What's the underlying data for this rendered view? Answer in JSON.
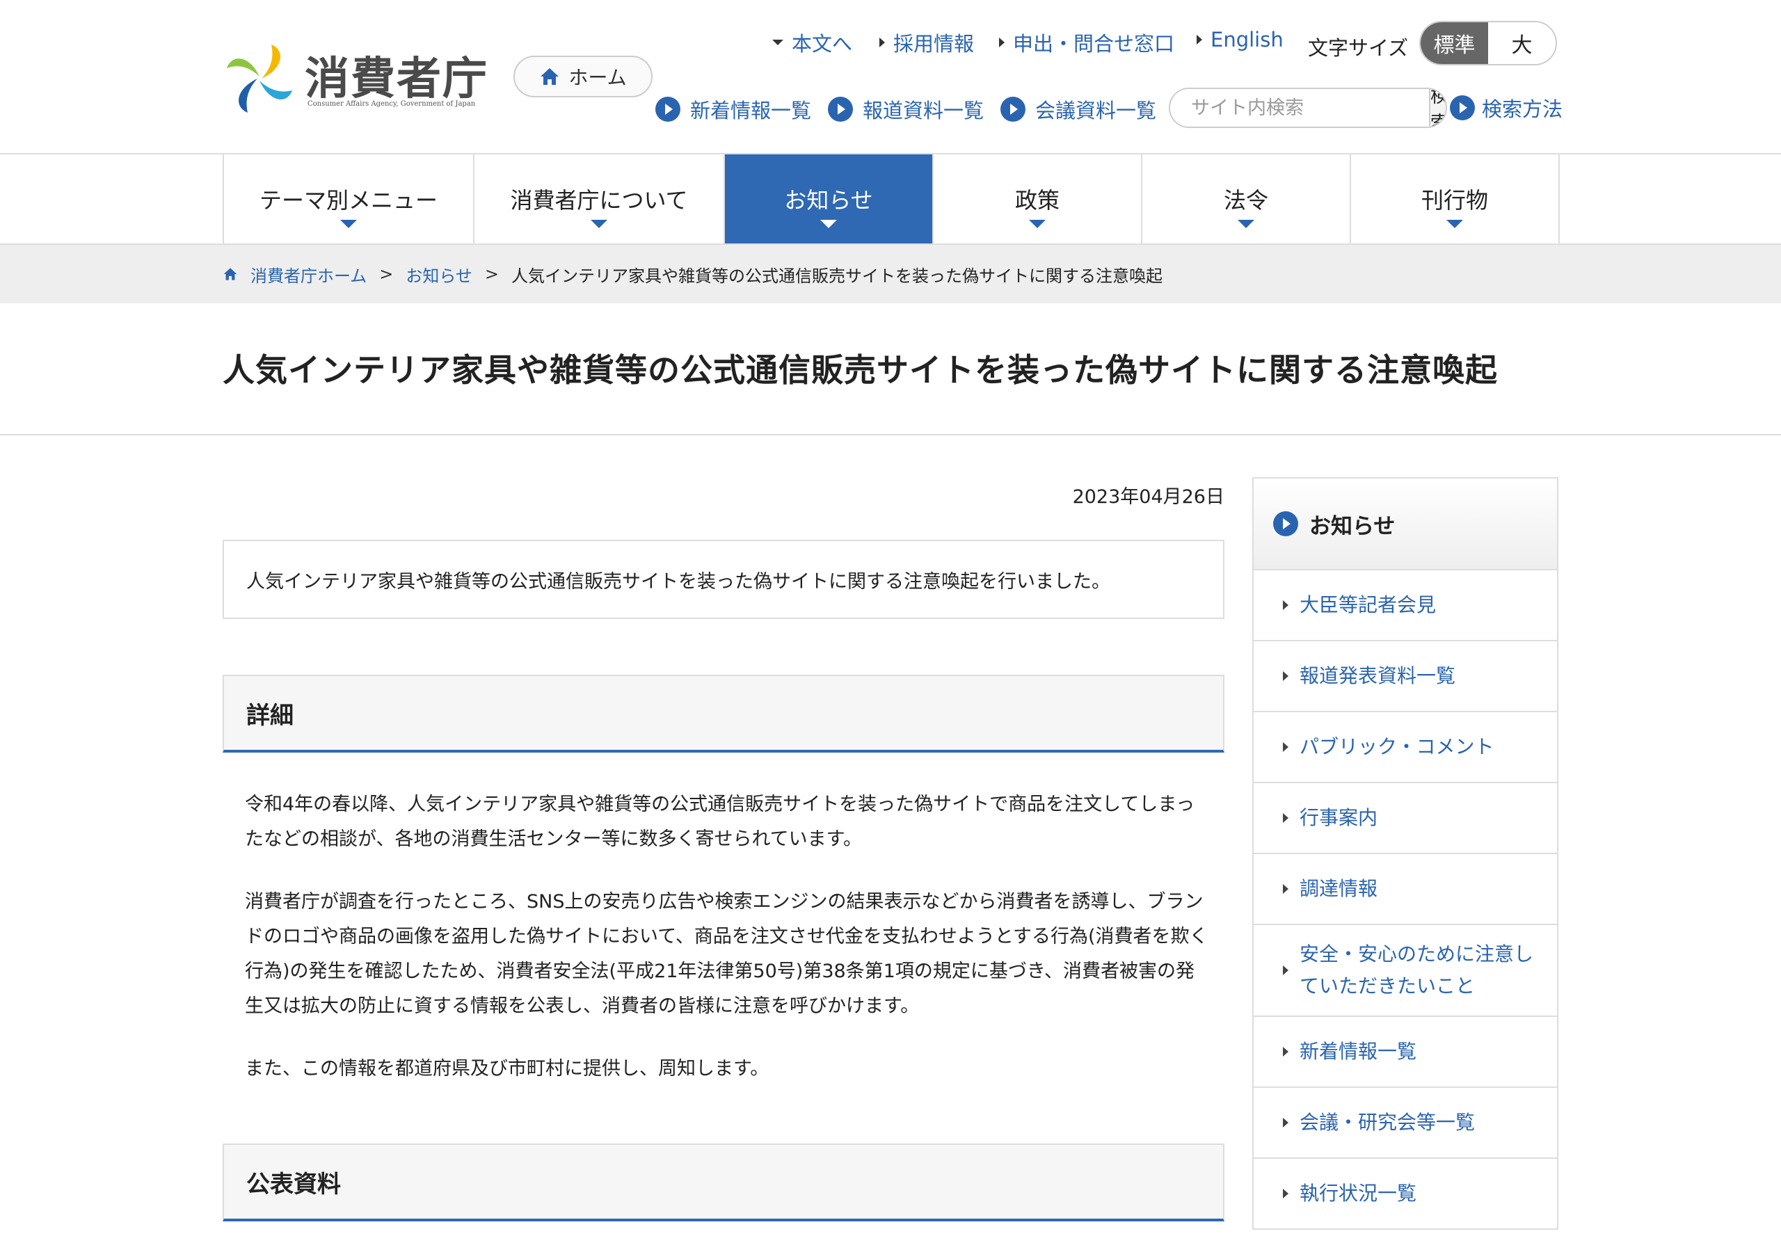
{
  "logo": {
    "name": "消費者庁",
    "subtitle": "Consumer Affairs Agency, Government of Japan"
  },
  "home_button": "ホーム",
  "utility_links": [
    "本文へ",
    "採用情報",
    "申出・問合せ窓口",
    "English"
  ],
  "font_size": {
    "label": "文字サイズ",
    "standard": "標準",
    "large": "大"
  },
  "quick_links": [
    "新着情報一覧",
    "報道資料一覧",
    "会議資料一覧"
  ],
  "search": {
    "placeholder": "サイト内検索",
    "button": "検索",
    "help_link": "検索方法"
  },
  "global_nav": [
    "テーマ別メニュー",
    "消費者庁について",
    "お知らせ",
    "政策",
    "法令",
    "刊行物"
  ],
  "breadcrumb": {
    "home": "消費者庁ホーム",
    "section": "お知らせ",
    "separator": ">",
    "current": "人気インテリア家具や雑貨等の公式通信販売サイトを装った偽サイトに関する注意喚起"
  },
  "page_title": "人気インテリア家具や雑貨等の公式通信販売サイトを装った偽サイトに関する注意喚起",
  "date": "2023年04月26日",
  "summary": "人気インテリア家具や雑貨等の公式通信販売サイトを装った偽サイトに関する注意喚起を行いました。",
  "details": {
    "heading": "詳細",
    "paragraphs": [
      "令和4年の春以降、人気インテリア家具や雑貨等の公式通信販売サイトを装った偽サイトで商品を注文してしまったなどの相談が、各地の消費生活センター等に数多く寄せられています。",
      "消費者庁が調査を行ったところ、SNS上の安売り広告や検索エンジンの結果表示などから消費者を誘導し、ブランドのロゴや商品の画像を盗用した偽サイトにおいて、商品を注文させ代金を支払わせようとする行為(消費者を欺く行為)の発生を確認したため、消費者安全法(平成21年法律第50号)第38条第1項の規定に基づき、消費者被害の発生又は拡大の防止に資する情報を公表し、消費者の皆様に注意を呼びかけます。",
      "また、この情報を都道府県及び市町村に提供し、周知します。"
    ]
  },
  "public_docs": {
    "heading": "公表資料"
  },
  "sidebar": {
    "title": "お知らせ",
    "items": [
      "大臣等記者会見",
      "報道発表資料一覧",
      "パブリック・コメント",
      "行事案内",
      "調達情報",
      "安全・安心のために注意していただきたいこと",
      "新着情報一覧",
      "会議・研究会等一覧",
      "執行状況一覧"
    ]
  },
  "colors": {
    "primary": "#2f68b3",
    "link": "#2a64b0",
    "border": "#dddddd"
  }
}
